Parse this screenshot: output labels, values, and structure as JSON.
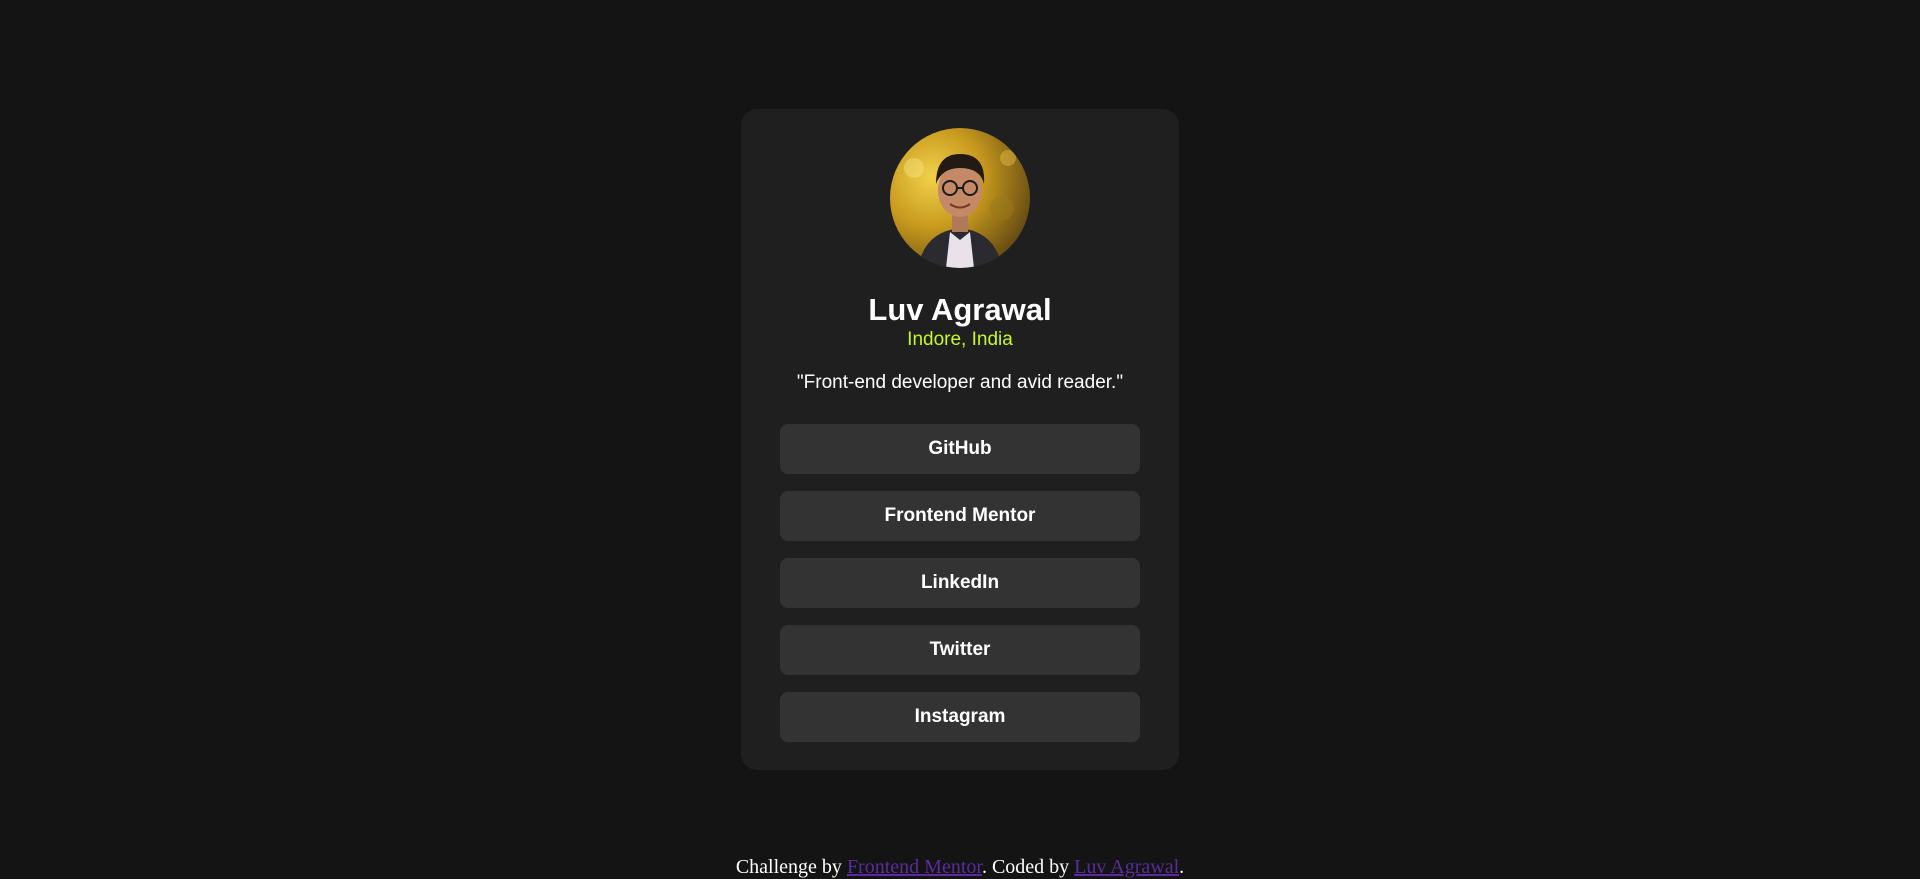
{
  "colors": {
    "page_background": "#141414",
    "card_background": "#1f1f1f",
    "button_background": "#333333",
    "accent_green": "#c4f82a",
    "link_purple": "#5a2b9d",
    "text": "#ffffff"
  },
  "profile": {
    "name": "Luv Agrawal",
    "location": "Indore, India",
    "bio": "\"Front-end developer and avid reader.\""
  },
  "links": [
    {
      "label": "GitHub"
    },
    {
      "label": "Frontend Mentor"
    },
    {
      "label": "LinkedIn"
    },
    {
      "label": "Twitter"
    },
    {
      "label": "Instagram"
    }
  ],
  "attribution": {
    "prefix": "Challenge by ",
    "challenge_link": "Frontend Mentor",
    "middle": ". Coded by ",
    "author_link": "Luv Agrawal",
    "suffix": "."
  }
}
